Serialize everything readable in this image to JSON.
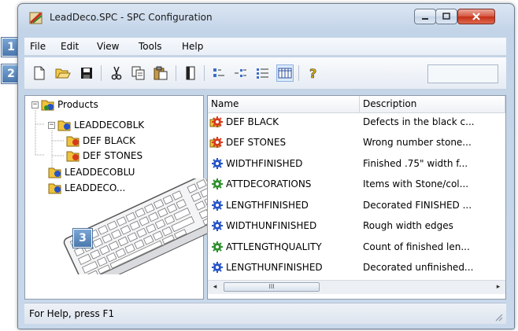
{
  "window": {
    "title": "LeadDeco.SPC - SPC Configuration"
  },
  "menu": {
    "items": [
      "File",
      "Edit",
      "View",
      "Tools",
      "Help"
    ]
  },
  "toolbar": {
    "buttons": [
      "new-icon",
      "open-icon",
      "save-icon",
      "cut-icon",
      "copy-icon",
      "paste-icon",
      "properties-icon",
      "small-icons-view-icon",
      "list-view-icon",
      "details-view-icon",
      "grid-view-icon",
      "help-icon"
    ]
  },
  "tree": {
    "root": "Products",
    "items": [
      {
        "label": "LEADDECOBLK",
        "children": [
          "DEF BLACK",
          "DEF STONES"
        ]
      },
      {
        "label": "LEADDECOBLU"
      },
      {
        "label": "LEADDECO..."
      }
    ]
  },
  "list": {
    "columns": [
      "Name",
      "Description"
    ],
    "rows": [
      {
        "name": "DEF BLACK",
        "description": "Defects in the black c...",
        "icon": "defect-gear-icon"
      },
      {
        "name": "DEF STONES",
        "description": "Wrong number stone...",
        "icon": "defect-gear-icon"
      },
      {
        "name": "WIDTHFINISHED",
        "description": "Finished .75\" width f...",
        "icon": "variable-gear-icon"
      },
      {
        "name": "ATTDECORATIONS",
        "description": "Items with Stone/col...",
        "icon": "attribute-gear-icon"
      },
      {
        "name": "LENGTHFINISHED",
        "description": "Decorated FINISHED ...",
        "icon": "variable-gear-icon"
      },
      {
        "name": "WIDTHUNFINISHED",
        "description": "Rough width edges",
        "icon": "variable-gear-icon"
      },
      {
        "name": "ATTLENGTHQUALITY",
        "description": "Count of finished len...",
        "icon": "attribute-gear-icon"
      },
      {
        "name": "LENGTHUNFINISHED",
        "description": "Decorated unfinished...",
        "icon": "variable-gear-icon"
      }
    ],
    "scroll_thumb": "III"
  },
  "status": {
    "text": "For Help, press F1"
  },
  "callouts": [
    "1",
    "2",
    "3"
  ],
  "colors": {
    "defect": "#d63a1c",
    "variable": "#2553c9",
    "attribute": "#2a8f2a",
    "folder": "#f0c23a"
  }
}
